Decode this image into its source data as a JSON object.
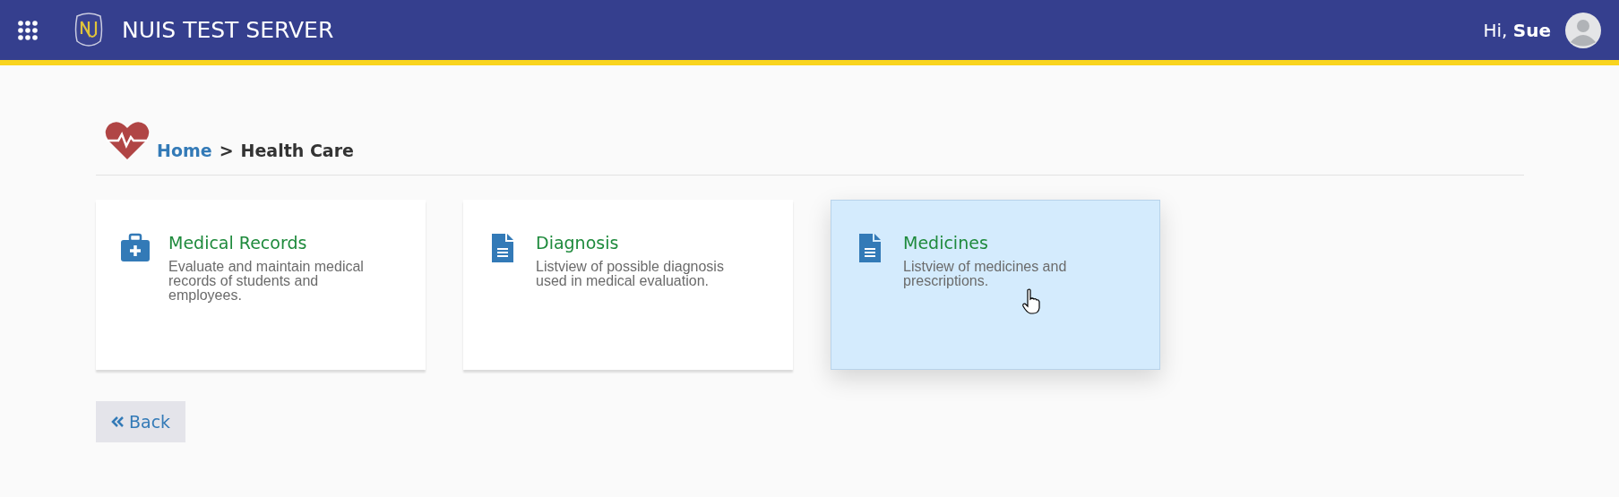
{
  "header": {
    "title": "NUIS TEST SERVER",
    "greeting": "Hi,",
    "user": "Sue"
  },
  "breadcrumb": {
    "items": [
      {
        "label": "Home",
        "kind": "link"
      },
      {
        "label": ">",
        "kind": "separator"
      },
      {
        "label": "Health Care",
        "kind": "current"
      }
    ]
  },
  "cards": [
    {
      "title": "Medical Records",
      "description": "Evaluate and maintain medical records of students and employees.",
      "kind": "medkit",
      "selected": false
    },
    {
      "title": "Diagnosis",
      "description": "Listview of possible diagnosis used in medical evaluation.",
      "kind": "file",
      "selected": false
    },
    {
      "title": "Medicines",
      "description": "Listview of medicines and prescriptions.",
      "kind": "file",
      "selected": true
    }
  ],
  "back_button": {
    "label": "Back"
  }
}
